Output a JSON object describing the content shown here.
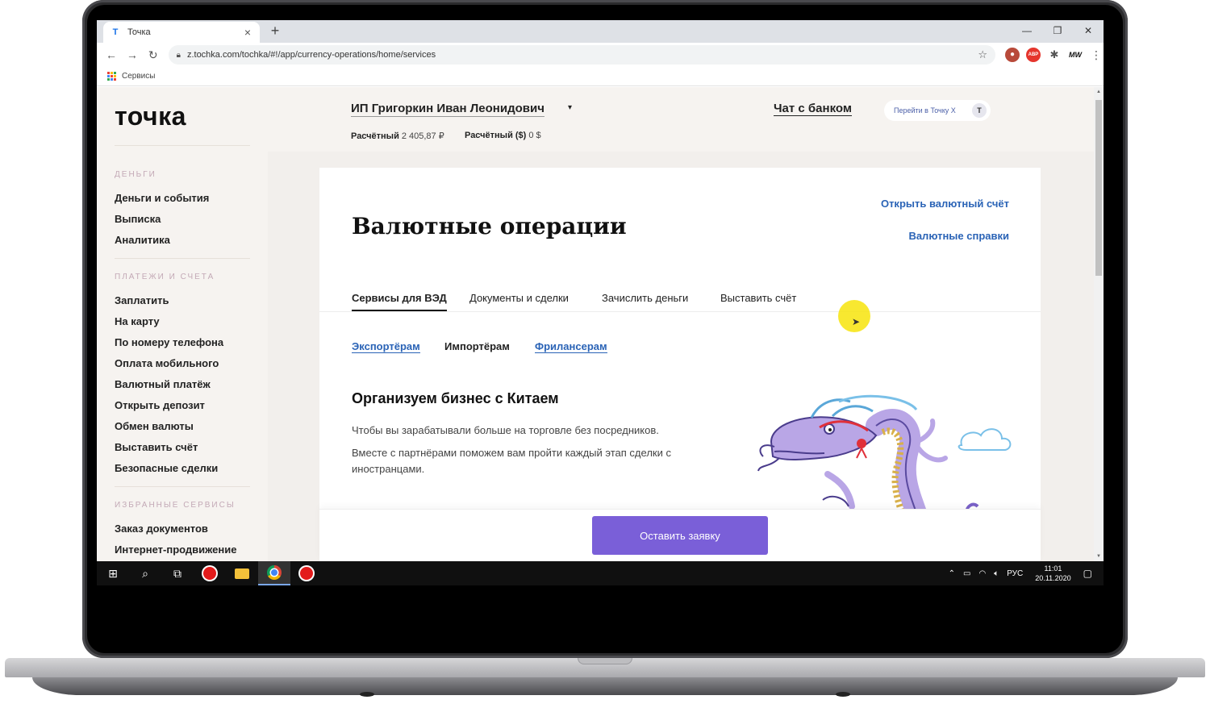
{
  "browser": {
    "tab_title": "Точка",
    "tab_favicon": "Т",
    "new_tab": "+",
    "url": "z.tochka.com/tochka/#!/app/currency-operations/home/services",
    "bookmark_label": "Сервисы",
    "ext_adblock": "ABP",
    "ext_mw": "MW"
  },
  "app": {
    "logo": "точка",
    "company": "ИП Григоркин Иван Леонидович",
    "accounts": [
      {
        "label": "Расчётный",
        "value": "2 405,87 ₽"
      },
      {
        "label": "Расчётный ($)",
        "value": "0 $"
      }
    ],
    "chat": "Чат с банком",
    "tochka_x": "Перейти в Точку Х",
    "tochka_x_badge": "T"
  },
  "sidebar": {
    "sections": [
      {
        "title": "ДЕНЬГИ",
        "items": [
          "Деньги и события",
          "Выписка",
          "Аналитика"
        ]
      },
      {
        "title": "ПЛАТЕЖИ И СЧЕТА",
        "items": [
          "Заплатить",
          "На карту",
          "По номеру телефона",
          "Оплата мобильного",
          "Валютный платёж",
          "Открыть депозит",
          "Обмен валюты",
          "Выставить счёт",
          "Безопасные сделки"
        ]
      },
      {
        "title": "ИЗБРАННЫЕ СЕРВИСЫ",
        "items": [
          "Заказ документов",
          "Интернет-продвижение"
        ]
      }
    ]
  },
  "content": {
    "title": "Валютные операции",
    "open_account_link": "Открыть валютный счёт",
    "certificates_link": "Валютные справки",
    "tabs": [
      "Сервисы для ВЭД",
      "Документы и сделки",
      "Зачислить деньги",
      "Выставить счёт"
    ],
    "subtabs": [
      "Экспортёрам",
      "Импортёрам",
      "Фрилансерам"
    ],
    "section_title": "Организуем бизнес с Китаем",
    "para1": "Чтобы вы зарабатывали больше на торговле без посредников.",
    "para2": "Вместе с партнёрами поможем вам пройти каждый этап сделки с иностранцами.",
    "cta": "Оставить заявку"
  },
  "taskbar": {
    "lang": "РУС",
    "time": "11:01",
    "date": "20.11.2020"
  }
}
